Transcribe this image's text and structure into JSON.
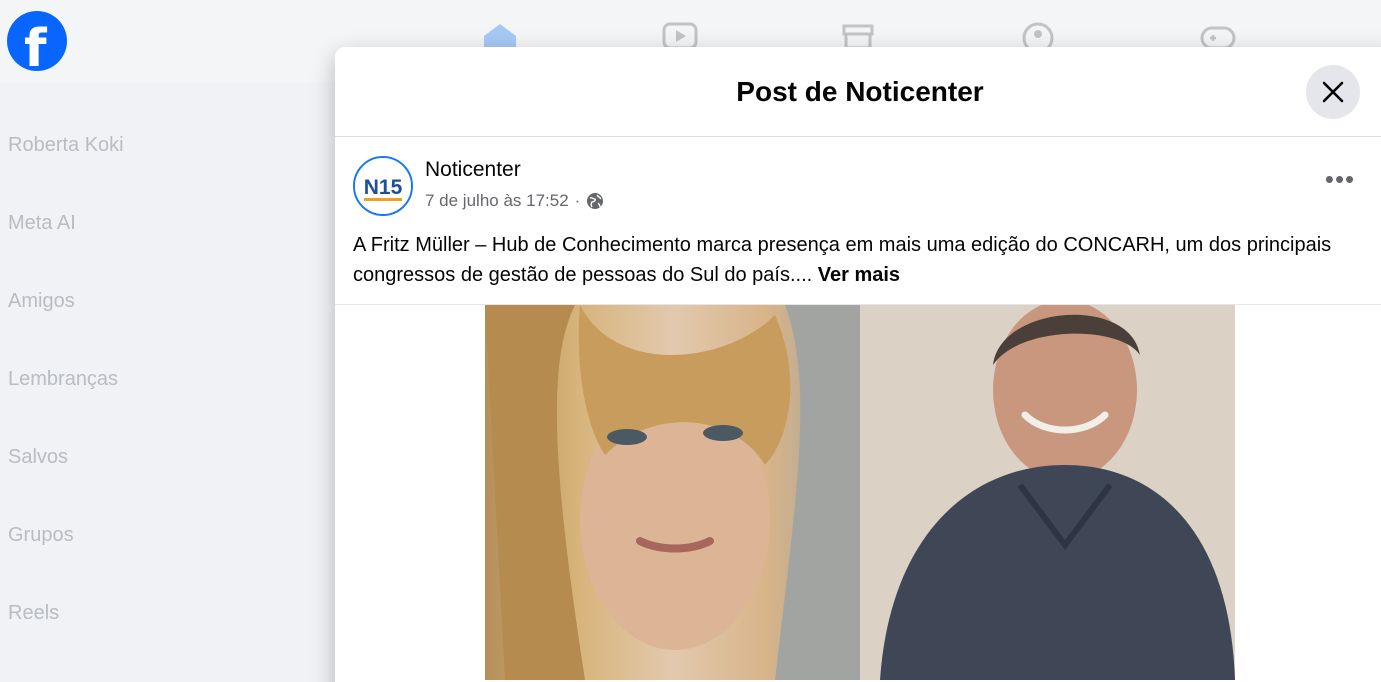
{
  "app": {
    "logo_glyph": "f"
  },
  "nav": {
    "icons": [
      "home-icon",
      "video-icon",
      "marketplace-icon",
      "groups-icon",
      "gaming-icon"
    ]
  },
  "sidebar": {
    "items": [
      {
        "label": "Roberta Koki"
      },
      {
        "label": "Meta AI"
      },
      {
        "label": "Amigos"
      },
      {
        "label": "Lembranças"
      },
      {
        "label": "Salvos"
      },
      {
        "label": "Grupos"
      },
      {
        "label": "Reels"
      }
    ]
  },
  "dialog": {
    "title": "Post de Noticenter",
    "close_icon": "close-icon"
  },
  "post": {
    "author": "Noticenter",
    "avatar_text": "N15",
    "timestamp": "7 de julho às 17:52",
    "separator": "·",
    "audience_icon": "globe-icon",
    "text": "A Fritz Müller – Hub de Conhecimento marca presença em mais uma edição do CONCARH, um dos principais congressos de gestão de pessoas do Sul do país.... ",
    "see_more": "Ver mais"
  },
  "colors": {
    "brand": "#0866ff",
    "text_primary": "#050505",
    "text_secondary": "#65676b",
    "close_bg": "#e4e6eb"
  }
}
